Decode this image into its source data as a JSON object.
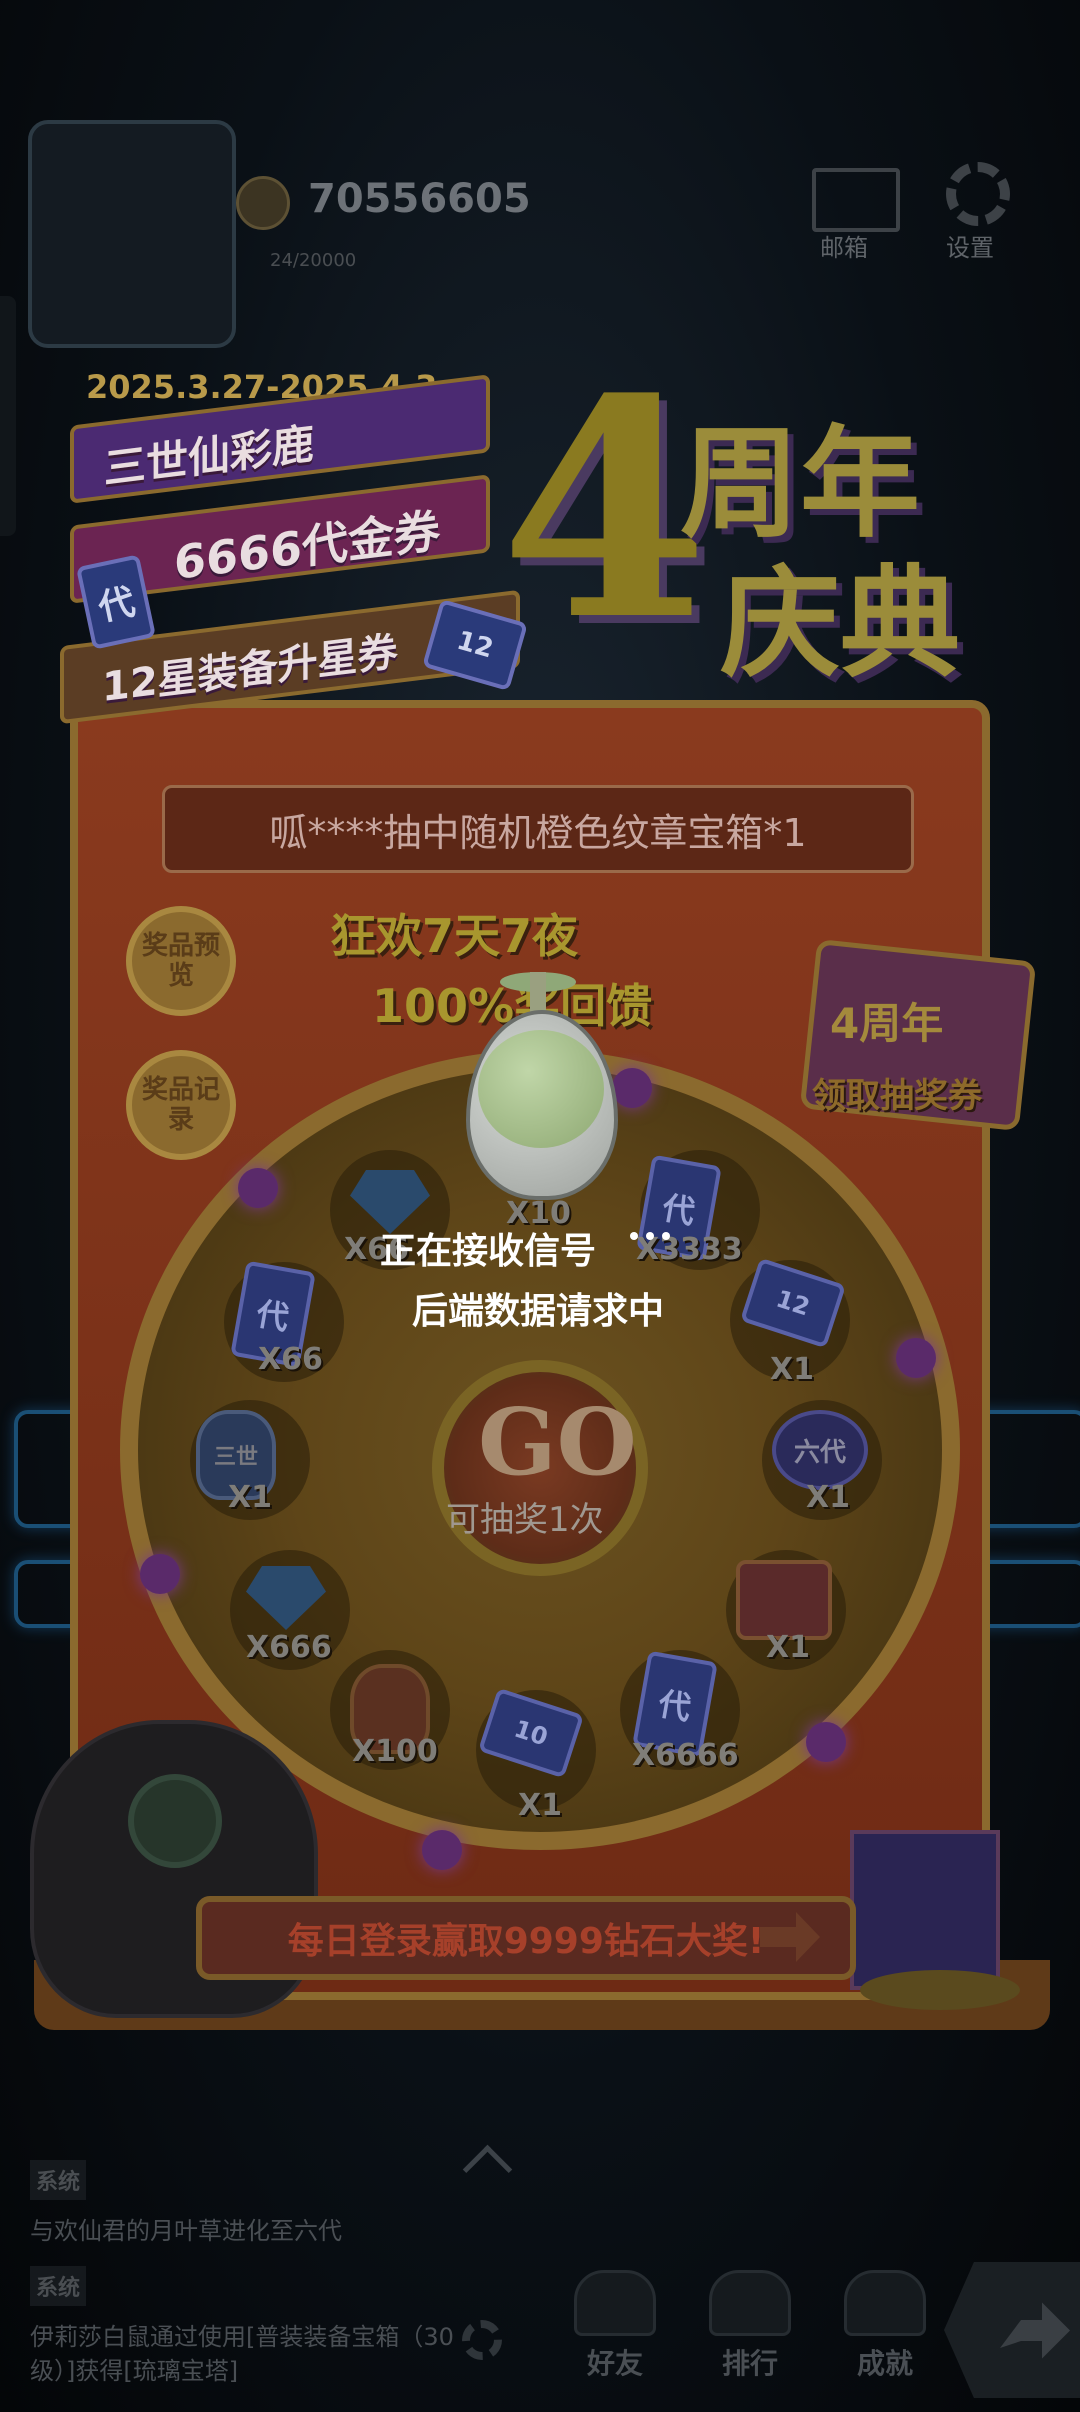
{
  "top": {
    "coins": "70556605",
    "sub_id": "24/20000",
    "mail_label": "邮箱",
    "settings_label": "设置"
  },
  "event": {
    "dates": "2025.3.27-2025.4.3",
    "ribbons": [
      "三世仙彩鹿",
      "6666代金券",
      "12星装备升星券"
    ],
    "ticket_glyph": "代",
    "star_ticket_badge": "12",
    "logo_number": "4",
    "logo_line1": "周年",
    "logo_line2": "庆典",
    "marquee": "呱****抽中随机橙色纹章宝箱*1",
    "side_buttons": [
      "奖品预览",
      "奖品记录"
    ],
    "headline_1": "狂欢7天7夜",
    "headline_2": "100%奖回馈",
    "claim_badge": "4周年",
    "claim_label": "领取抽奖券",
    "go_text": "GO",
    "go_sub": "可抽奖1次",
    "banner": "每日登录赢取9999钻石大奖!"
  },
  "wheel": {
    "prizes": [
      {
        "name": "gem",
        "label": "X10"
      },
      {
        "name": "ticket",
        "label": "X3333"
      },
      {
        "name": "star-ticket",
        "label": "X1",
        "badge": "12"
      },
      {
        "name": "sixth-gen",
        "label": "X1",
        "badge": "六代"
      },
      {
        "name": "chest",
        "label": "X1"
      },
      {
        "name": "ticket",
        "label": "X6666"
      },
      {
        "name": "star-ticket",
        "label": "X1",
        "badge": "10"
      },
      {
        "name": "pot",
        "label": "X100"
      },
      {
        "name": "gem",
        "label": "X666"
      },
      {
        "name": "deer",
        "label": "X1",
        "badge": "三世"
      },
      {
        "name": "ticket",
        "label": "X66"
      },
      {
        "name": "gem",
        "label": "X66"
      }
    ]
  },
  "loading": {
    "line1": "正在接收信号",
    "line2": "后端数据请求中"
  },
  "chat": [
    {
      "tag": "系统",
      "text": "与欢仙君的月叶草进化至六代"
    },
    {
      "tag": "系统",
      "text": "伊莉莎白鼠通过使用[普装装备宝箱（30级）]获得[琉璃宝塔]"
    }
  ],
  "nav": [
    "好友",
    "排行",
    "成就"
  ],
  "colors": {
    "overlay": "#05080b",
    "loading_text": "#ffffff"
  }
}
